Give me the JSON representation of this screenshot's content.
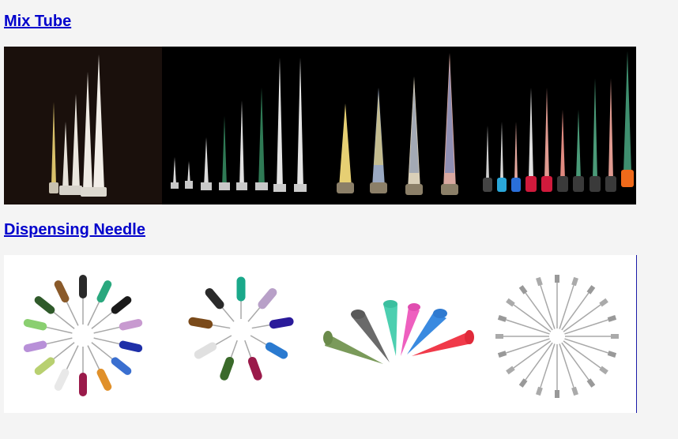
{
  "sections": {
    "mix_tube": {
      "title": "Mix Tube",
      "images": [
        {
          "name": "mix-tube-set-white"
        },
        {
          "name": "mix-tube-set-green"
        },
        {
          "name": "mix-tube-set-yellow-blue"
        },
        {
          "name": "mix-tube-set-colored-bases"
        }
      ]
    },
    "dispensing_needle": {
      "title": "Dispensing Needle",
      "images": [
        {
          "name": "needle-fan-mixed-colors"
        },
        {
          "name": "needle-fan-dark-colors"
        },
        {
          "name": "tapered-tips-colored"
        },
        {
          "name": "steel-needle-fan"
        }
      ]
    }
  },
  "colors": {
    "link": "#0000cc",
    "page_background": "#f4f4f4"
  }
}
